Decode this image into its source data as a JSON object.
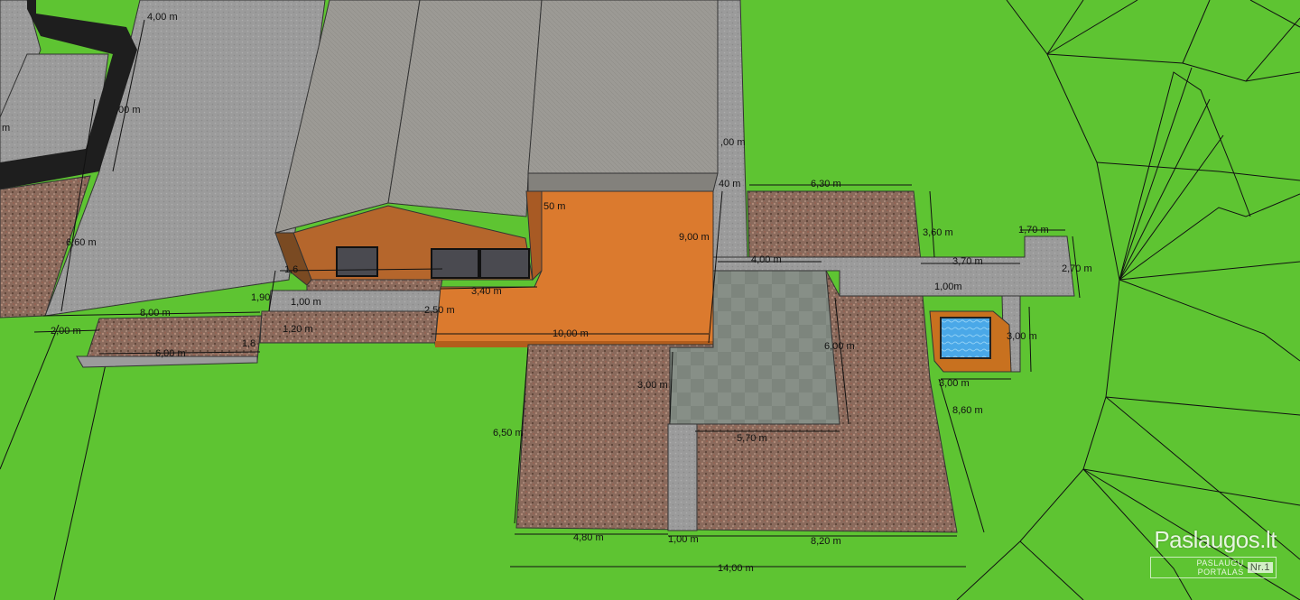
{
  "colors": {
    "grass": "#5ec432",
    "grass_dark": "#52b02a",
    "roof": "#9c9a95",
    "roof_dark": "#83817c",
    "wall_wood": "#b5662c",
    "deck": "#db7a2e",
    "deck_edge": "#b25d1c",
    "paving": "#9b9b9b",
    "gravel": "#8a6a5c",
    "tile": "#7d857d",
    "pool_water": "#4aa8e8",
    "pool_frame": "#c8711f",
    "fence": "#1e1e1e",
    "window": "#4a4a50"
  },
  "dimensions": [
    {
      "id": "d1",
      "text": "4,00 m"
    },
    {
      "id": "d2",
      "text": ",00 m"
    },
    {
      "id": "d3",
      "text": "6,60 m"
    },
    {
      "id": "d4",
      "text": "8,00 m"
    },
    {
      "id": "d5",
      "text": "2,00 m"
    },
    {
      "id": "d6",
      "text": "6,00 m"
    },
    {
      "id": "d7",
      "text": "1,90"
    },
    {
      "id": "d8",
      "text": "1,6"
    },
    {
      "id": "d9",
      "text": "1,00 m"
    },
    {
      "id": "d10",
      "text": "1,20 m"
    },
    {
      "id": "d11",
      "text": "1,8"
    },
    {
      "id": "d12",
      "text": "2,50 m"
    },
    {
      "id": "d13",
      "text": "3,40 m"
    },
    {
      "id": "d14",
      "text": "50 m"
    },
    {
      "id": "d15",
      "text": "10,00 m"
    },
    {
      "id": "d16",
      "text": "9,00 m"
    },
    {
      "id": "d17",
      "text": ",00 m"
    },
    {
      "id": "d18",
      "text": "40 m"
    },
    {
      "id": "d19",
      "text": "6,30 m"
    },
    {
      "id": "d20",
      "text": "3,60 m"
    },
    {
      "id": "d21",
      "text": "1,70 m"
    },
    {
      "id": "d22",
      "text": "2,70 m"
    },
    {
      "id": "d23",
      "text": "3,70 m"
    },
    {
      "id": "d24",
      "text": "4,00 m"
    },
    {
      "id": "d25",
      "text": "1,00m"
    },
    {
      "id": "d26",
      "text": "3,00 m"
    },
    {
      "id": "d27",
      "text": "3,00 m"
    },
    {
      "id": "d28",
      "text": "6,00 m"
    },
    {
      "id": "d29",
      "text": "3,00 m"
    },
    {
      "id": "d30",
      "text": "5,70 m"
    },
    {
      "id": "d31",
      "text": "6,50 m"
    },
    {
      "id": "d32",
      "text": "8,60 m"
    },
    {
      "id": "d33",
      "text": "4,80 m"
    },
    {
      "id": "d34",
      "text": "1,00 m"
    },
    {
      "id": "d35",
      "text": "8,20 m"
    },
    {
      "id": "d36",
      "text": "14,00 m"
    },
    {
      "id": "d37",
      "text": "m"
    }
  ],
  "watermark": {
    "brand": "Paslaugos.lt",
    "tagline": "PASLAUGŲ PORTALAS",
    "rank": "Nr.1"
  }
}
